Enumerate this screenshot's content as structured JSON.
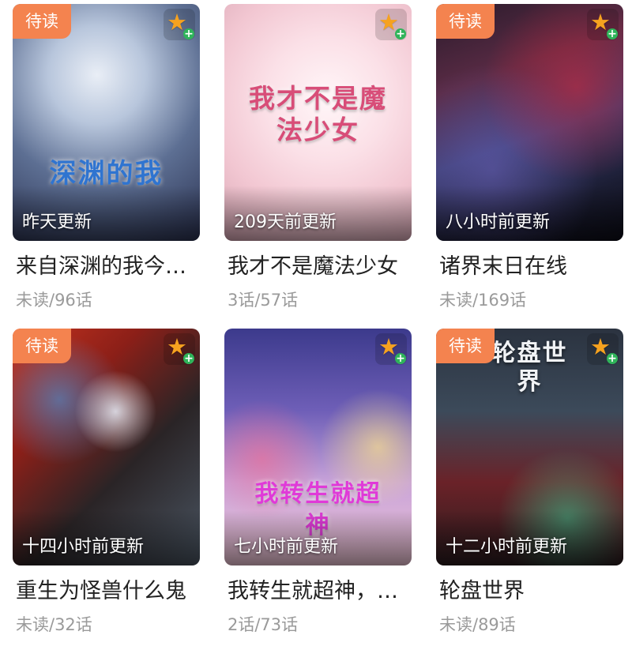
{
  "colors": {
    "badge_bg": "#f4834f",
    "star": "#f6a21f",
    "plus": "#2fb45a",
    "title_text": "#222222",
    "meta_text": "#9a9a9a"
  },
  "cards": [
    {
      "badge": "待读",
      "update": "昨天更新",
      "title": "来自深渊的我今…",
      "progress": "未读/96话",
      "art_text": "深渊的我",
      "fav_icon": "star-add-icon"
    },
    {
      "badge": "",
      "update": "209天前更新",
      "title": "我才不是魔法少女",
      "progress": "3话/57话",
      "art_text": "我才不是魔法少女",
      "fav_icon": "star-add-icon"
    },
    {
      "badge": "待读",
      "update": "八小时前更新",
      "title": "诸界末日在线",
      "progress": "未读/169话",
      "art_text": "",
      "fav_icon": "star-add-icon"
    },
    {
      "badge": "待读",
      "update": "十四小时前更新",
      "title": "重生为怪兽什么鬼",
      "progress": "未读/32话",
      "art_text": "",
      "fav_icon": "star-add-icon"
    },
    {
      "badge": "",
      "update": "七小时前更新",
      "title": "我转生就超神，…",
      "progress": "2话/73话",
      "art_text": "我转生就超神",
      "fav_icon": "star-add-icon"
    },
    {
      "badge": "待读",
      "update": "十二小时前更新",
      "title": "轮盘世界",
      "progress": "未读/89话",
      "art_text": "轮盘世界",
      "fav_icon": "star-add-icon"
    }
  ]
}
